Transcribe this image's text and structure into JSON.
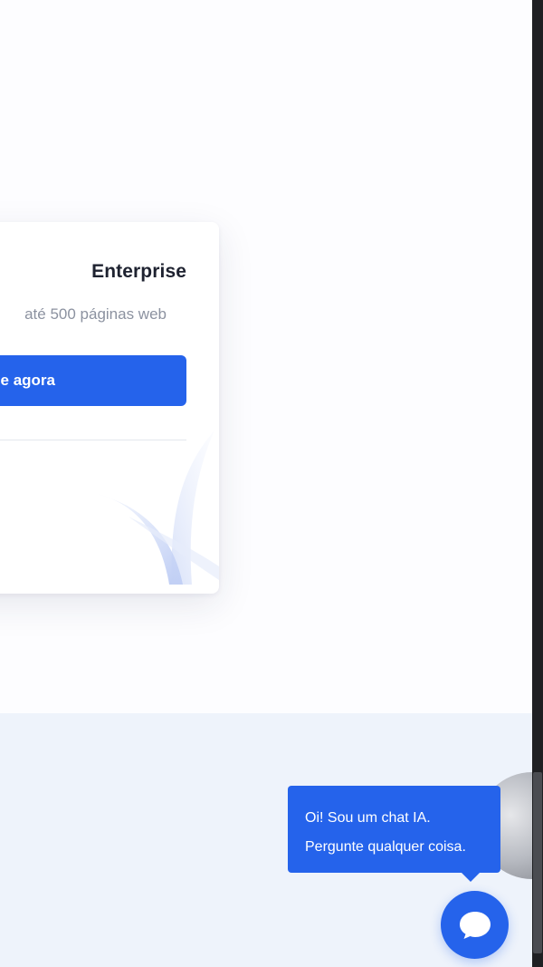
{
  "pricing_card": {
    "title": "Enterprise",
    "description": "até 500 páginas web",
    "cta_label": "e agora"
  },
  "chat_widget": {
    "greeting_line_1": "Oi! Sou um chat IA.",
    "greeting_line_2": "Pergunte qualquer coisa.",
    "button_icon": "chat-bubble-icon"
  },
  "colors": {
    "accent": "#2563eb",
    "title_text": "#1e2230",
    "muted_text": "#8c92a0",
    "band_background": "#eef3fb"
  }
}
